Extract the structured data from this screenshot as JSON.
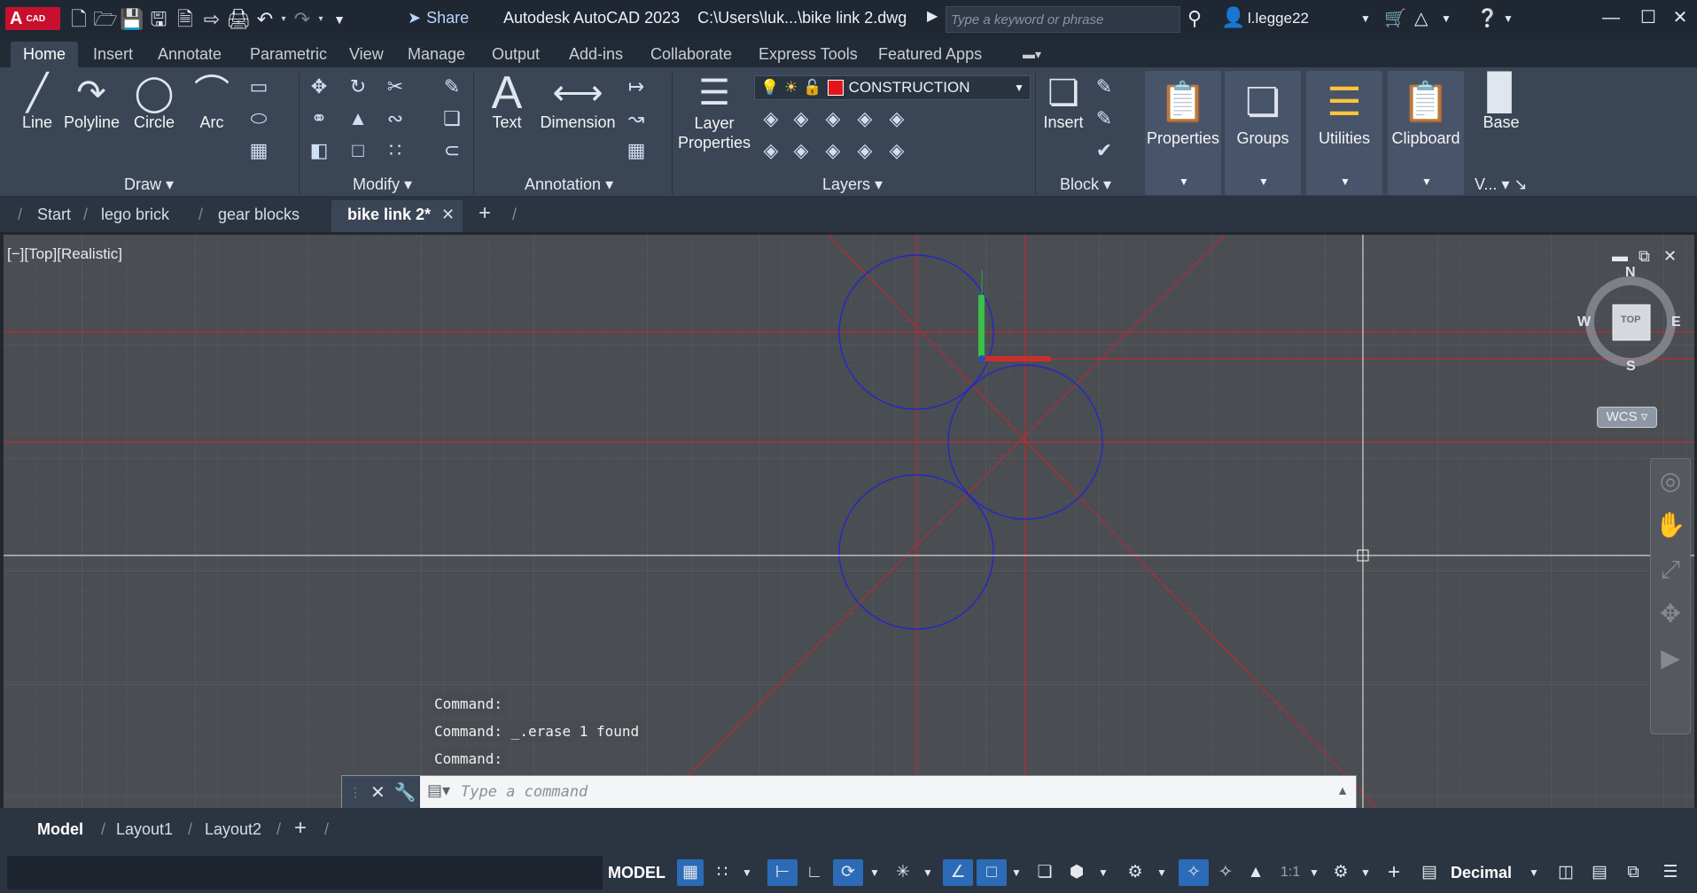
{
  "titlebar": {
    "logo_big": "A",
    "logo_small": "CAD",
    "share_label": "Share",
    "app_title": "Autodesk AutoCAD 2023",
    "file_path": "C:\\Users\\luk...\\bike link 2.dwg",
    "search_placeholder": "Type a keyword or phrase",
    "user_name": "l.legge22"
  },
  "ribbon_tabs": [
    "Home",
    "Insert",
    "Annotate",
    "Parametric",
    "View",
    "Manage",
    "Output",
    "Add-ins",
    "Collaborate",
    "Express Tools",
    "Featured Apps"
  ],
  "ribbon": {
    "draw": {
      "line": "Line",
      "polyline": "Polyline",
      "circle": "Circle",
      "arc": "Arc",
      "panel": "Draw"
    },
    "modify": {
      "panel": "Modify"
    },
    "annotation": {
      "text": "Text",
      "dimension": "Dimension",
      "panel": "Annotation"
    },
    "layers": {
      "layer_properties_1": "Layer",
      "layer_properties_2": "Properties",
      "current_layer": "CONSTRUCTION",
      "panel": "Layers"
    },
    "block": {
      "insert": "Insert",
      "panel": "Block"
    },
    "properties": "Properties",
    "groups": "Groups",
    "utilities": "Utilities",
    "clipboard": "Clipboard",
    "view": {
      "base": "Base",
      "panel": "V..."
    }
  },
  "file_tabs": [
    "Start",
    "lego brick",
    "gear blocks",
    "bike link 2*"
  ],
  "viewport": {
    "label": "[−][Top][Realistic]",
    "compass": {
      "n": "N",
      "s": "S",
      "e": "E",
      "w": "W",
      "face": "TOP"
    },
    "wcs": "WCS"
  },
  "command": {
    "history": [
      "Command:",
      "Command: _.erase 1 found",
      "Command:"
    ],
    "placeholder": "Type a command"
  },
  "layout_tabs": [
    "Model",
    "Layout1",
    "Layout2"
  ],
  "status": {
    "model": "MODEL",
    "scale": "1:1",
    "units": "Decimal"
  },
  "colors": {
    "accent": "#2c6bb7",
    "construction_red": "#e3151b",
    "circle_blue": "#2626c8",
    "viewport_bg": "#4a4d52"
  },
  "icons": [
    "new-icon",
    "open-icon",
    "save-icon",
    "saveas-icon",
    "plot-icon",
    "undo-icon",
    "redo-icon",
    "search-icon",
    "user-icon",
    "cart-icon",
    "help-icon"
  ]
}
